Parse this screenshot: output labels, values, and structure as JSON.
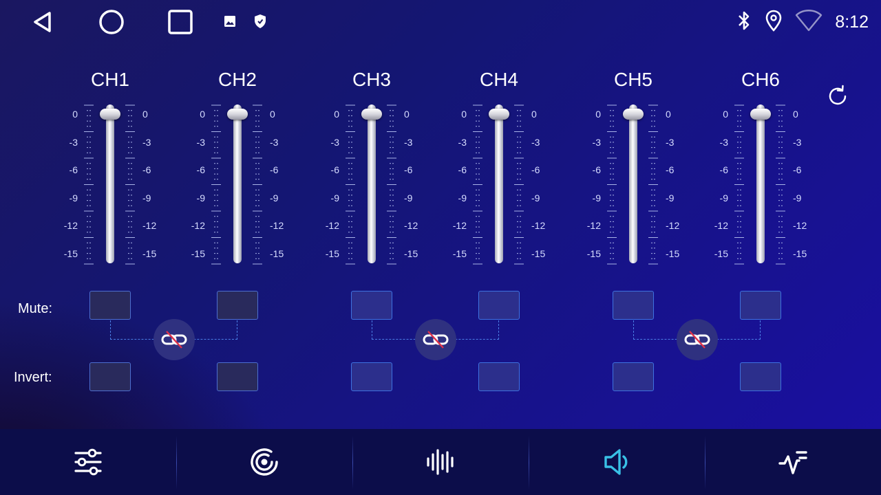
{
  "status_bar": {
    "time": "8:12",
    "nav": [
      "back-icon",
      "home-icon",
      "recents-icon"
    ],
    "notifications": [
      "image-icon",
      "shield-icon"
    ],
    "indicators": [
      "bluetooth-icon",
      "location-icon",
      "wifi-icon"
    ]
  },
  "mixer": {
    "channels": [
      {
        "label": "CH1",
        "level_db": 0
      },
      {
        "label": "CH2",
        "level_db": 0
      },
      {
        "label": "CH3",
        "level_db": 0
      },
      {
        "label": "CH4",
        "level_db": 0
      },
      {
        "label": "CH5",
        "level_db": 0
      },
      {
        "label": "CH6",
        "level_db": 0
      }
    ],
    "scale_labels": [
      "0",
      "-3",
      "-6",
      "-9",
      "-12",
      "-15"
    ],
    "mute_label": "Mute:",
    "invert_label": "Invert:",
    "reset_icon": "refresh-icon",
    "link_icon": "unlink-icon"
  },
  "bottom_nav": {
    "tabs": [
      {
        "icon": "sliders-icon",
        "active": false
      },
      {
        "icon": "sound-field-icon",
        "active": false
      },
      {
        "icon": "waveform-icon",
        "active": false
      },
      {
        "icon": "speaker-icon",
        "active": true
      },
      {
        "icon": "pulse-icon",
        "active": false
      }
    ]
  },
  "colors": {
    "accent": "#39c0e6",
    "toggle_border": "#3e72e0",
    "background": "#141673"
  }
}
